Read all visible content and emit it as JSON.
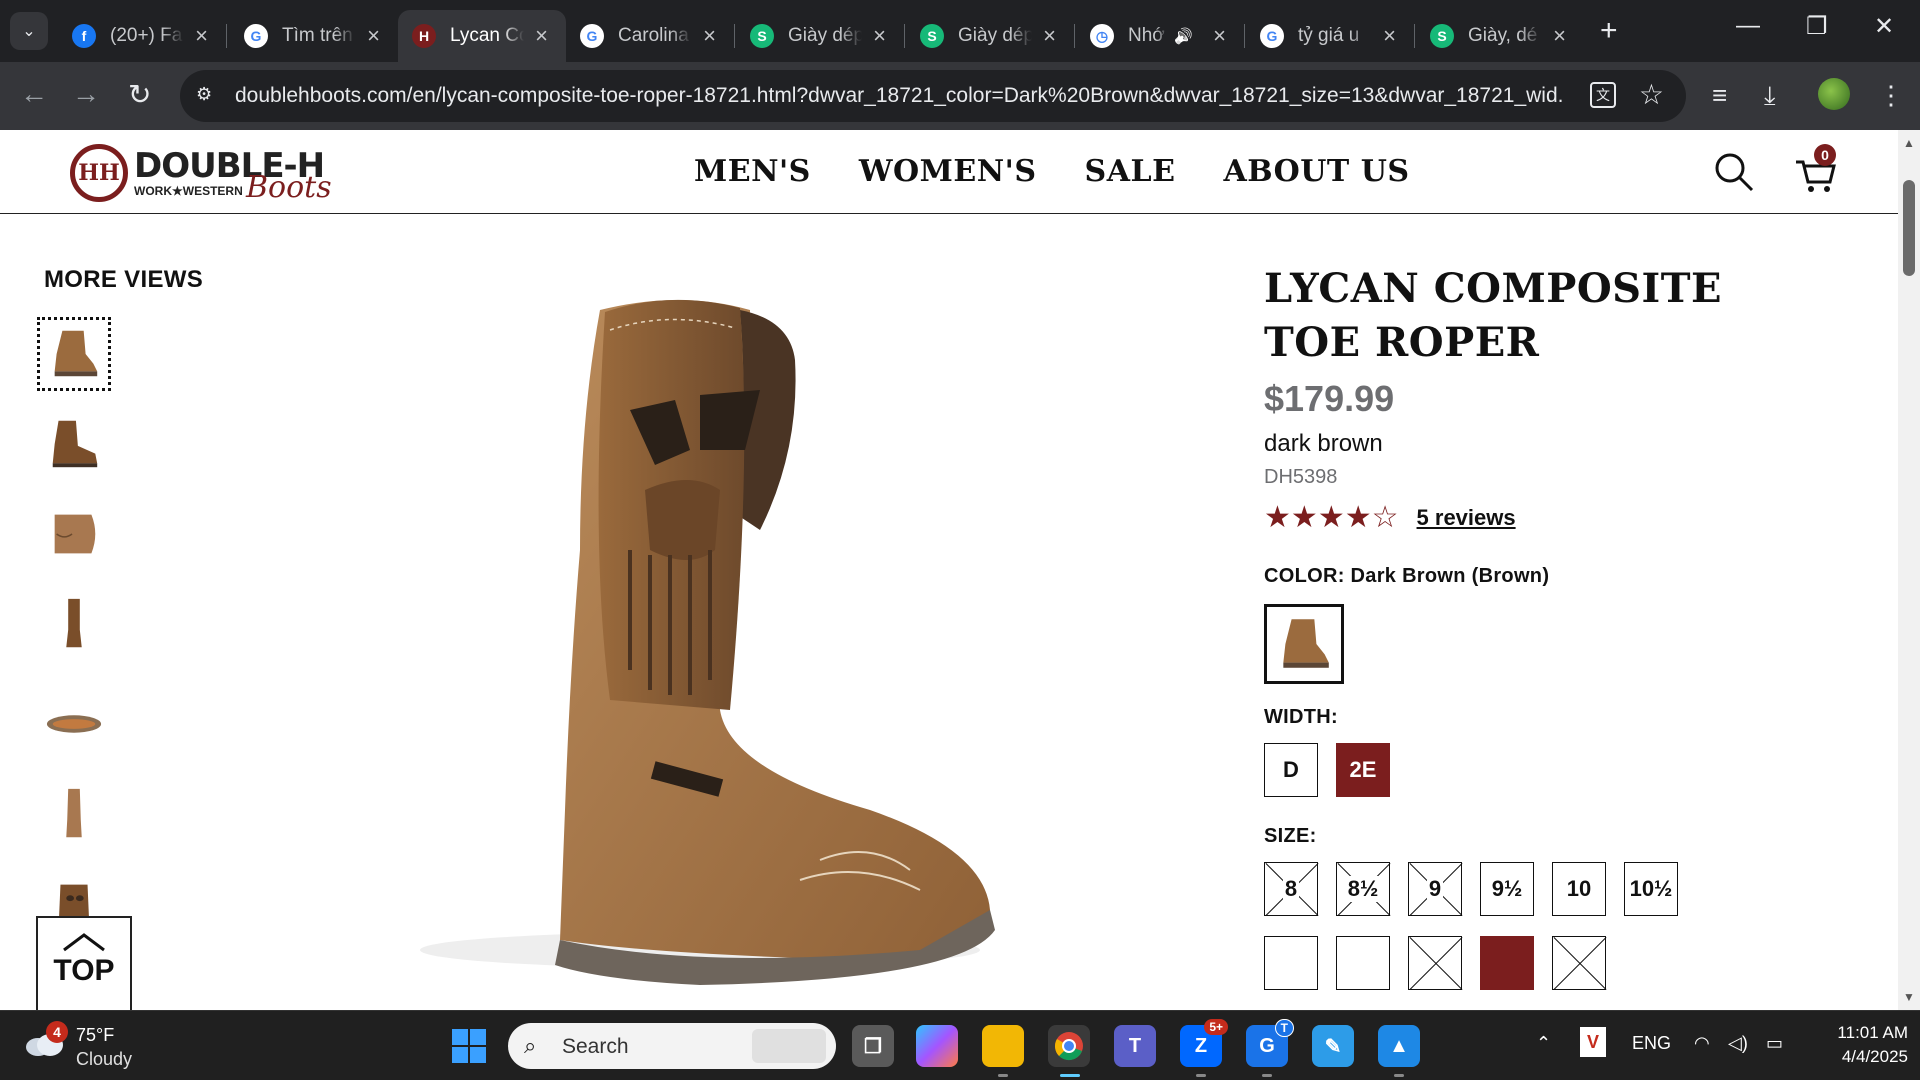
{
  "browser": {
    "tabs": [
      {
        "title": "(20+) Fa",
        "favicon": "facebook-icon",
        "color": "#1877f2",
        "glyph": "f"
      },
      {
        "title": "Tìm trên",
        "favicon": "google-icon",
        "color": "#ffffff",
        "glyph": "G"
      },
      {
        "title": "Lycan Co",
        "favicon": "double-h-icon",
        "color": "#7b1e1e",
        "glyph": "H",
        "active": true
      },
      {
        "title": "Carolina",
        "favicon": "google-icon",
        "color": "#ffffff",
        "glyph": "G"
      },
      {
        "title": "Giày dép",
        "favicon": "s-icon",
        "color": "#17b978",
        "glyph": "S"
      },
      {
        "title": "Giày dép",
        "favicon": "s-icon",
        "color": "#17b978",
        "glyph": "S"
      },
      {
        "title": "Nhớ",
        "favicon": "clock-icon",
        "color": "#ffffff",
        "glyph": "◷",
        "audio": true
      },
      {
        "title": "tỷ giá u",
        "favicon": "google-icon",
        "color": "#ffffff",
        "glyph": "G"
      },
      {
        "title": "Giày, dé",
        "favicon": "s-icon",
        "color": "#17b978",
        "glyph": "S"
      }
    ],
    "url": "doublehboots.com/en/lycan-composite-toe-roper-18721.html?dwvar_18721_color=Dark%20Brown&dwvar_18721_size=13&dwvar_18721_wid..."
  },
  "site": {
    "logo_brand": "DOUBLE-H",
    "logo_tag": "WORK★WESTERN",
    "logo_script": "Boots",
    "nav": [
      "MEN'S",
      "WOMEN'S",
      "SALE",
      "ABOUT US"
    ],
    "cart_count": "0"
  },
  "gallery": {
    "heading": "MORE VIEWS",
    "back_to_top": "TOP"
  },
  "product": {
    "title": "LYCAN COMPOSITE TOE ROPER",
    "price": "$179.99",
    "color_name": "dark brown",
    "sku": "DH5398",
    "rating": 4,
    "rating_max": 5,
    "reviews": "5 reviews",
    "color_label": "COLOR: Dark Brown (Brown)",
    "width_label": "WIDTH:",
    "widths": [
      {
        "label": "D",
        "selected": false
      },
      {
        "label": "2E",
        "selected": true
      }
    ],
    "size_label": "SIZE:",
    "sizes": [
      {
        "label": "8",
        "available": false
      },
      {
        "label": "8½",
        "available": false
      },
      {
        "label": "9",
        "available": false
      },
      {
        "label": "9½",
        "available": true
      },
      {
        "label": "10",
        "available": true
      },
      {
        "label": "10½",
        "available": true
      }
    ],
    "accent_color": "#7b1e1e"
  },
  "taskbar": {
    "weather_badge": "4",
    "temperature": "75°F",
    "condition": "Cloudy",
    "search_placeholder": "Search",
    "zalo_badge": "5+",
    "teams_badge": "T",
    "language": "ENG",
    "time": "11:01 AM",
    "date": "4/4/2025"
  }
}
